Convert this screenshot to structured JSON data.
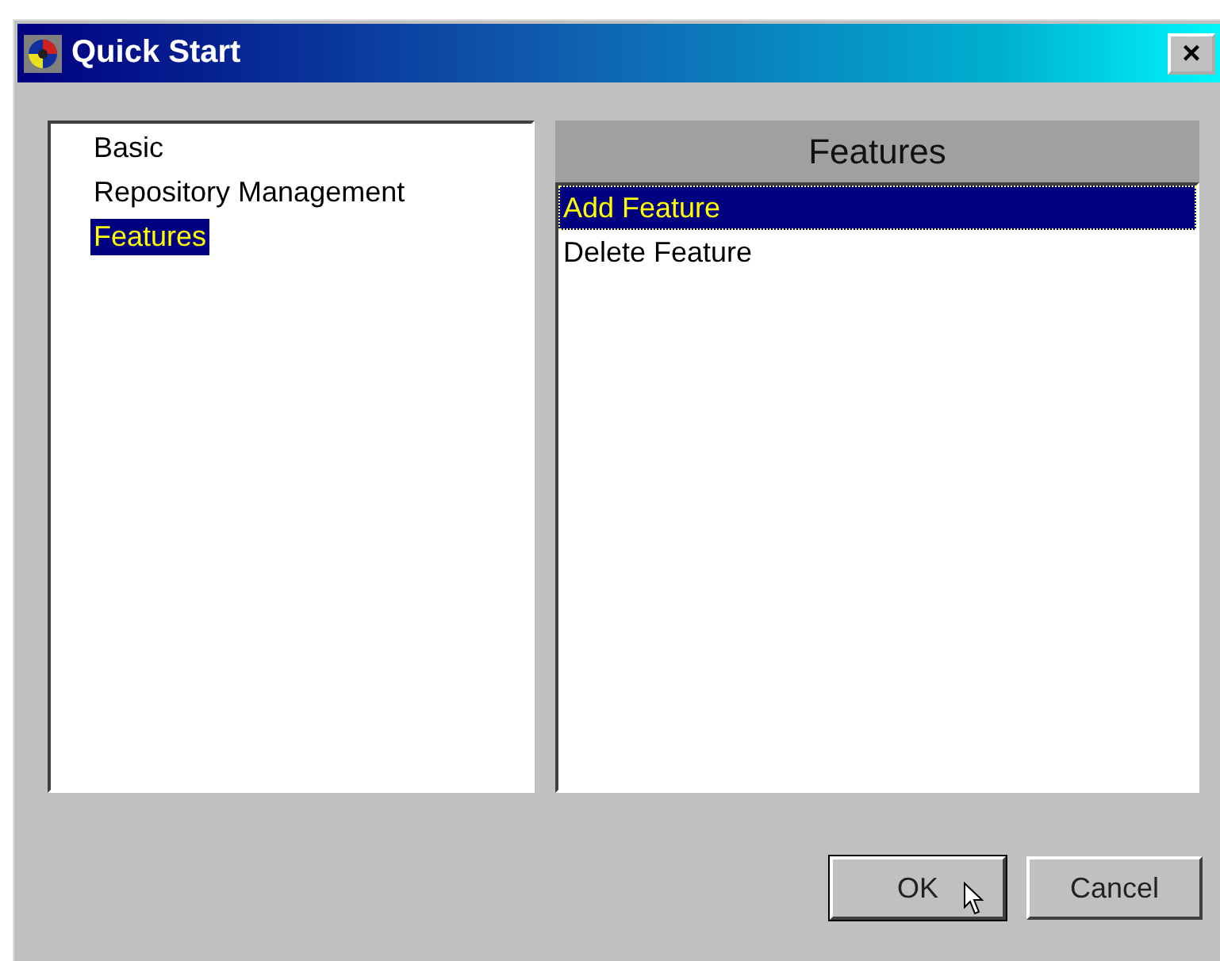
{
  "window": {
    "title": "Quick Start",
    "close": "×"
  },
  "categories": [
    {
      "label": "Basic",
      "selected": false
    },
    {
      "label": "Repository Management",
      "selected": false
    },
    {
      "label": "Features",
      "selected": true
    }
  ],
  "panel": {
    "title": "Features",
    "items": [
      {
        "label": "Add Feature",
        "selected": true
      },
      {
        "label": "Delete Feature",
        "selected": false
      }
    ]
  },
  "buttons": [
    {
      "label": "OK",
      "default": true
    },
    {
      "label": "Cancel",
      "default": false
    }
  ]
}
